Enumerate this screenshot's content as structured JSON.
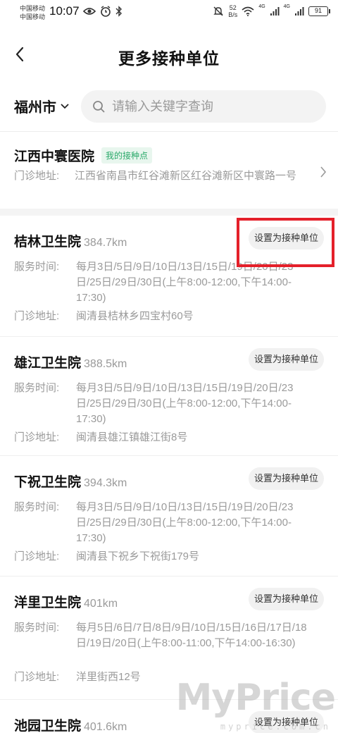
{
  "status_bar": {
    "carrier_1": "中国移动",
    "carrier_2": "中国移动",
    "time": "10:07",
    "net_speed_value": "52",
    "net_speed_unit": "B/s",
    "signal_tag_1": "4G",
    "signal_tag_2": "4G",
    "battery": "91",
    "icons": [
      "eye-icon",
      "alarm-icon",
      "bluetooth-icon",
      "mute-icon",
      "wifi-icon",
      "signal-icon"
    ]
  },
  "header": {
    "title": "更多接种单位"
  },
  "search": {
    "city": "福州市",
    "placeholder": "请输入关键字查询"
  },
  "current_unit": {
    "name": "江西中寰医院",
    "tag": "我的接种点",
    "address_label": "门诊地址:",
    "address": "江西省南昌市红谷滩新区红谷滩新区中寰路一号"
  },
  "labels": {
    "service_time": "服务时间:",
    "address": "门诊地址:",
    "set_button": "设置为接种单位"
  },
  "units": [
    {
      "name": "桔林卫生院",
      "distance": "384.7km",
      "service_time": "每月3日/5日/9日/10日/13日/15日/19日/20日/23日/25日/29日/30日(上午8:00-12:00,下午14:00-17:30)",
      "address": "闽清县桔林乡四宝村60号"
    },
    {
      "name": "雄江卫生院",
      "distance": "388.5km",
      "service_time": "每月3日/5日/9日/10日/13日/15日/19日/20日/23日/25日/29日/30日(上午8:00-12:00,下午14:00-17:30)",
      "address": "闽清县雄江镇雄江街8号"
    },
    {
      "name": "下祝卫生院",
      "distance": "394.3km",
      "service_time": "每月3日/5日/9日/10日/13日/15日/19日/20日/23日/25日/29日/30日(上午8:00-12:00,下午14:00-17:30)",
      "address": "闽清县下祝乡下祝街179号"
    },
    {
      "name": "洋里卫生院",
      "distance": "401km",
      "service_time": "每月5日/6日/7日/8日/9日/10日/15日/16日/17日/18日/19日/20日(上午8:00-11:00,下午14:00-16:30)",
      "address": "洋里街西12号"
    },
    {
      "name": "池园卫生院",
      "distance": "401.6km",
      "service_time": "",
      "address": ""
    }
  ],
  "watermark": {
    "brand": "MyPrice",
    "url": "myprice.com.cn"
  },
  "colors": {
    "accent_green": "#2aa96a",
    "highlight_red": "#e4202a"
  }
}
